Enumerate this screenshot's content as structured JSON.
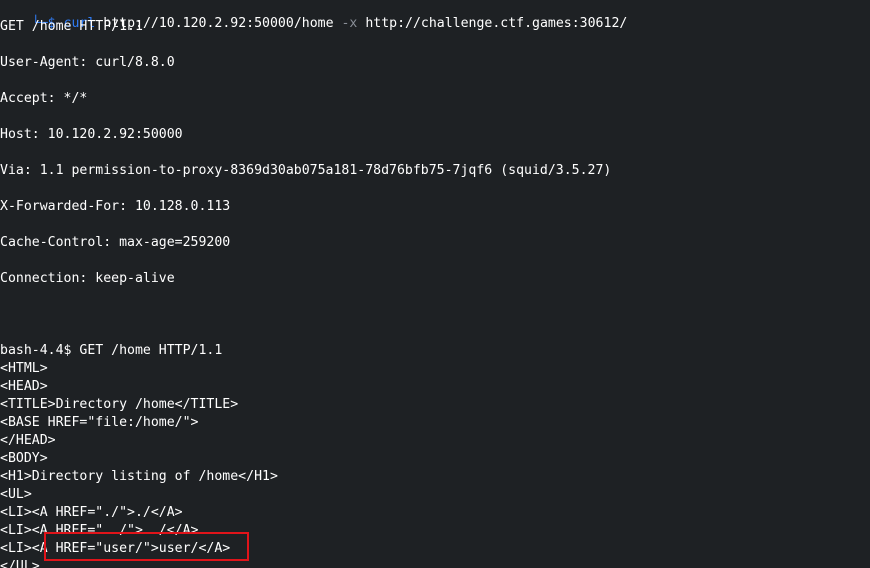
{
  "prompt": {
    "corner": "└─$",
    "command": "curl",
    "target": "http://10.120.2.92:50000/home",
    "flag": "-x",
    "proxy": "http://challenge.ctf.games:30612/"
  },
  "request_lines": [
    "GET /home HTTP/1.1",
    "User-Agent: curl/8.8.0",
    "Accept: */*",
    "Host: 10.120.2.92:50000",
    "Via: 1.1 permission-to-proxy-8369d30ab075a181-78d76bfb75-7jqf6 (squid/3.5.27)",
    "X-Forwarded-For: 10.128.0.113",
    "Cache-Control: max-age=259200",
    "Connection: keep-alive"
  ],
  "response_lines": [
    "bash-4.4$ GET /home HTTP/1.1",
    "<HTML>",
    "<HEAD>",
    "<TITLE>Directory /home</TITLE>",
    "<BASE HREF=\"file:/home/\">",
    "</HEAD>",
    "<BODY>",
    "<H1>Directory listing of /home</H1>",
    "<UL>",
    "<LI><A HREF=\"./\">./</A>",
    "<LI><A HREF=\"../\">../</A>",
    "<LI><A HREF=\"user/\">user/</A>",
    "</UL>"
  ],
  "colors": {
    "background": "#1e2124",
    "prompt_blue": "#2f7cf5",
    "highlight_red": "#e0141a"
  }
}
